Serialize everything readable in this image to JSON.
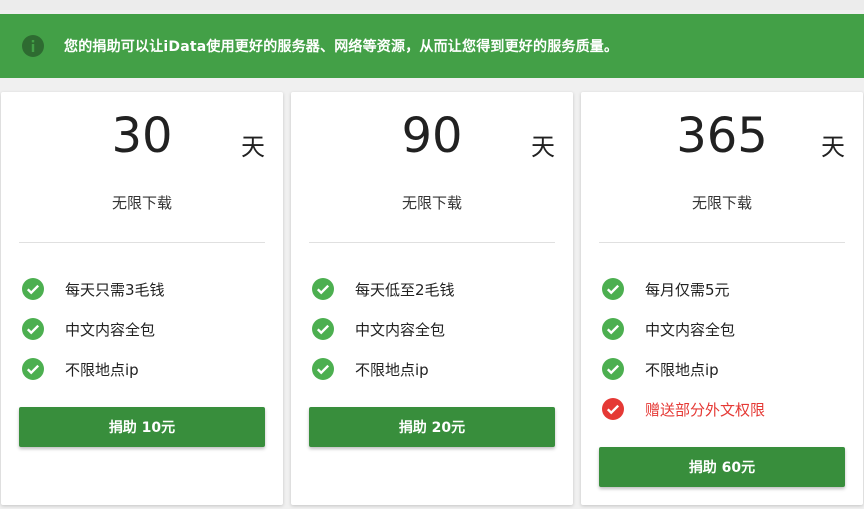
{
  "alert": {
    "icon": "info-icon",
    "text": "您的捐助可以让iData使用更好的服务器、网络等资源，从而让您得到更好的服务质量。",
    "color": "#43a047"
  },
  "plans": [
    {
      "days": "30",
      "unit": "天",
      "subtitle": "无限下载",
      "features": [
        {
          "text": "每天只需3毛钱",
          "icon": "check-circle-icon"
        },
        {
          "text": "中文内容全包",
          "icon": "check-circle-icon"
        },
        {
          "text": "不限地点ip",
          "icon": "check-circle-icon"
        }
      ],
      "button": "捐助 10元"
    },
    {
      "days": "90",
      "unit": "天",
      "subtitle": "无限下载",
      "features": [
        {
          "text": "每天低至2毛钱",
          "icon": "check-circle-icon"
        },
        {
          "text": "中文内容全包",
          "icon": "check-circle-icon"
        },
        {
          "text": "不限地点ip",
          "icon": "check-circle-icon"
        }
      ],
      "button": "捐助 20元"
    },
    {
      "days": "365",
      "unit": "天",
      "subtitle": "无限下载",
      "features": [
        {
          "text": "每月仅需5元",
          "icon": "check-circle-icon"
        },
        {
          "text": "中文内容全包",
          "icon": "check-circle-icon"
        },
        {
          "text": "不限地点ip",
          "icon": "check-circle-icon"
        },
        {
          "text": "赠送部分外文权限",
          "icon": "check-circle-icon",
          "bonus": true
        }
      ],
      "button": "捐助 60元"
    }
  ],
  "colors": {
    "check": "#4caf50",
    "bonus_check": "#e53935",
    "button": "#388e3c"
  }
}
